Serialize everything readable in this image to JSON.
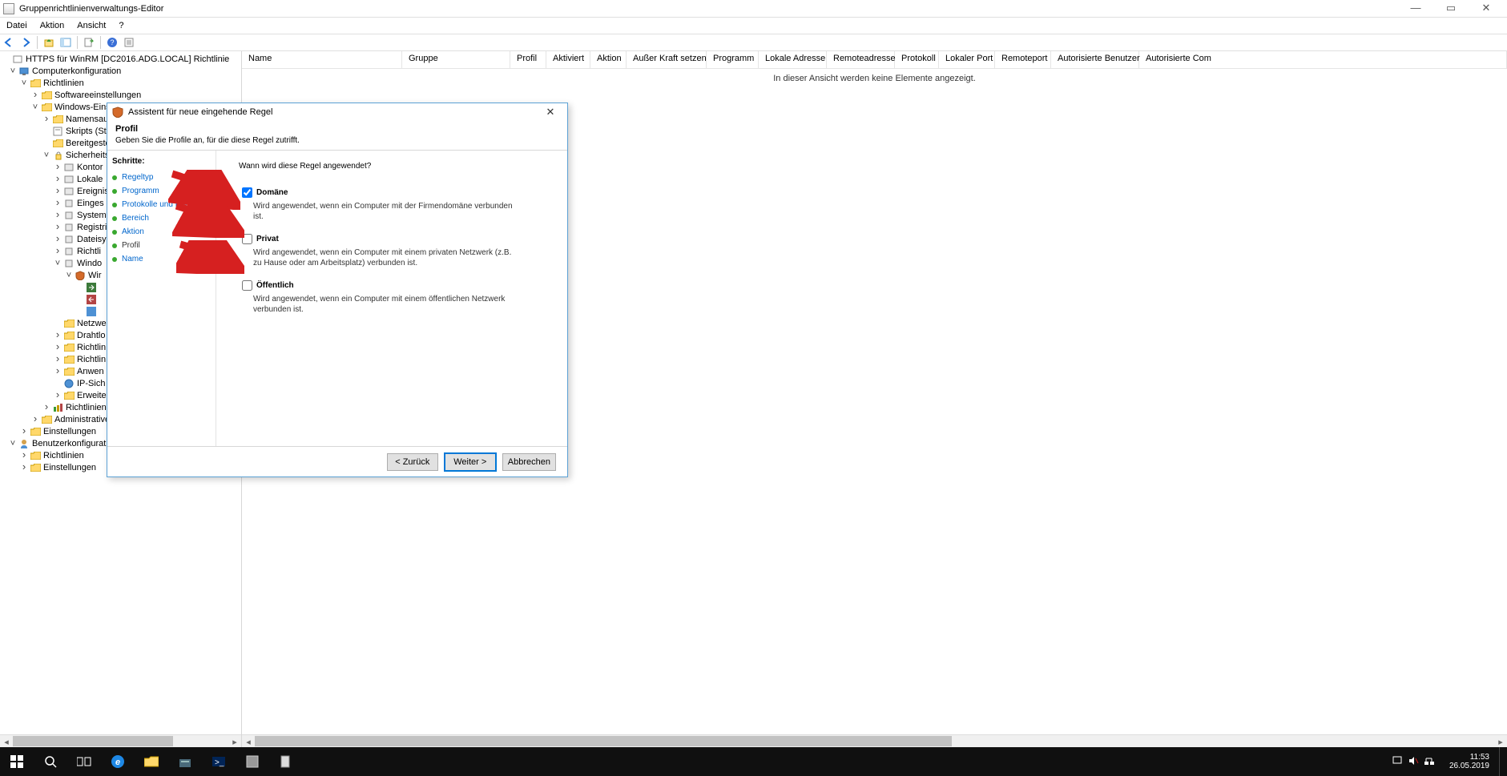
{
  "window": {
    "title": "Gruppenrichtlinienverwaltungs-Editor"
  },
  "menu": {
    "items": [
      "Datei",
      "Aktion",
      "Ansicht",
      "?"
    ]
  },
  "tree": {
    "root": "HTTPS für WinRM [DC2016.ADG.LOCAL] Richtlinie",
    "n_compconf": "Computerkonfiguration",
    "n_richt": "Richtlinien",
    "n_soft": "Softwareeinstellungen",
    "n_wineinst": "Windows-Einst",
    "n_namens": "Namensau",
    "n_skripts": "Skripts (Sta",
    "n_bereit": "Bereitgeste",
    "n_sicher": "Sicherheits",
    "n_kontor": "Kontor",
    "n_lokale": "Lokale",
    "n_ereignis": "Ereignis",
    "n_einges": "Einges",
    "n_system": "System",
    "n_registri": "Registri",
    "n_dateisy": "Dateisy",
    "n_richtli": "Richtli",
    "n_windo2": "Windo",
    "n_wir": "Wir",
    "n_netzwe": "Netzwe",
    "n_drahtlo": "Drahtlo",
    "n_richtlin1": "Richtlin",
    "n_richtlin2": "Richtlin",
    "n_anwen": "Anwen",
    "n_ipsich": "IP-Sich",
    "n_erweite": "Erweite",
    "n_richtadmin": "Richtlinien",
    "n_adminv": "Administrative",
    "n_einst2": "Einstellungen",
    "n_benutzer": "Benutzerkonfiguration",
    "n_brichtl": "Richtlinien",
    "n_beinst": "Einstellungen"
  },
  "columns": [
    "Name",
    "Gruppe",
    "Profil",
    "Aktiviert",
    "Aktion",
    "Außer Kraft setzen",
    "Programm",
    "Lokale Adresse",
    "Remoteadresse",
    "Protokoll",
    "Lokaler Port",
    "Remoteport",
    "Autorisierte Benutzer",
    "Autorisierte Com"
  ],
  "empty": "In dieser Ansicht werden keine Elemente angezeigt.",
  "dialog": {
    "title": "Assistent für neue eingehende Regel",
    "heading": "Profil",
    "subheading": "Geben Sie die Profile an, für die diese Regel zutrifft.",
    "steps_label": "Schritte:",
    "steps": {
      "regeltyp": "Regeltyp",
      "programm": "Programm",
      "protokolle": "Protokolle und Ports",
      "bereich": "Bereich",
      "aktion": "Aktion",
      "profil": "Profil",
      "name": "Name"
    },
    "question": "Wann wird diese Regel angewendet?",
    "chk_domaene": "Domäne",
    "desc_domaene": "Wird angewendet, wenn ein Computer mit der Firmendomäne verbunden ist.",
    "chk_privat": "Privat",
    "desc_privat": "Wird angewendet, wenn ein Computer mit einem privaten Netzwerk (z.B. zu Hause oder am Arbeitsplatz) verbunden ist.",
    "chk_oeffentlich": "Öffentlich",
    "desc_oeffentlich": "Wird angewendet, wenn ein Computer mit einem öffentlichen Netzwerk verbunden ist.",
    "btn_back": "< Zurück",
    "btn_next": "Weiter >",
    "btn_cancel": "Abbrechen"
  },
  "taskbar": {
    "time": "11:53",
    "date": "26.05.2019"
  }
}
